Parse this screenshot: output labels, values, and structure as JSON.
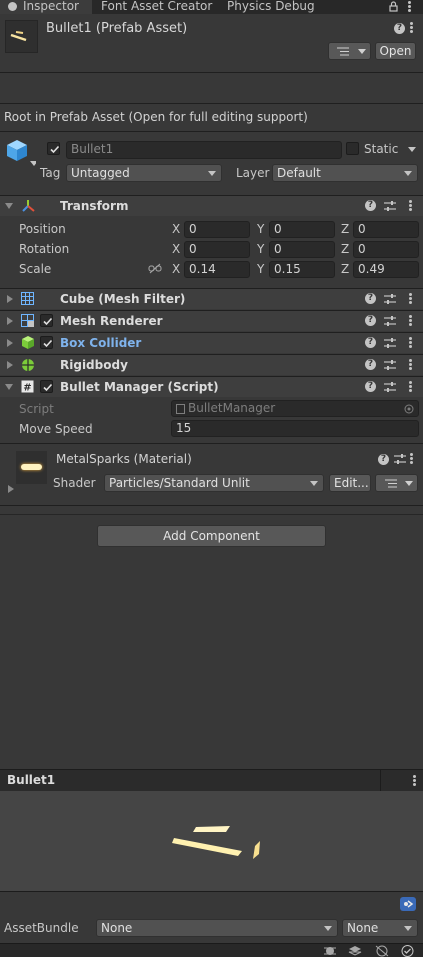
{
  "tabs": [
    {
      "label": "Inspector",
      "active": true
    },
    {
      "label": "Font Asset Creator",
      "active": false
    },
    {
      "label": "Physics Debug",
      "active": false
    }
  ],
  "header": {
    "title": "Bullet1 (Prefab Asset)",
    "open_label": "Open",
    "root_message": "Root in Prefab Asset (Open for full editing support)"
  },
  "gameobject": {
    "name": "Bullet1",
    "active": true,
    "static_label": "Static",
    "tag_label": "Tag",
    "tag_value": "Untagged",
    "layer_label": "Layer",
    "layer_value": "Default"
  },
  "transform": {
    "title": "Transform",
    "rows": [
      {
        "label": "Position",
        "x": "0",
        "y": "0",
        "z": "0"
      },
      {
        "label": "Rotation",
        "x": "0",
        "y": "0",
        "z": "0"
      },
      {
        "label": "Scale",
        "x": "0.14",
        "y": "0.15",
        "z": "0.49"
      }
    ],
    "axis_x": "X",
    "axis_y": "Y",
    "axis_z": "Z"
  },
  "components": [
    {
      "name": "Cube (Mesh Filter)",
      "icon": "mesh-filter-icon",
      "checkbox": false,
      "color": "#dcdcdc"
    },
    {
      "name": "Mesh Renderer",
      "icon": "mesh-renderer-icon",
      "checkbox": true,
      "color": "#dcdcdc"
    },
    {
      "name": "Box Collider",
      "icon": "box-collider-icon",
      "checkbox": true,
      "color": "#7fb3ec"
    },
    {
      "name": "Rigidbody",
      "icon": "rigidbody-icon",
      "checkbox": false,
      "color": "#dcdcdc"
    },
    {
      "name": "Bullet Manager (Script)",
      "icon": "script-icon",
      "checkbox": true,
      "color": "#dcdcdc"
    }
  ],
  "script": {
    "script_label": "Script",
    "script_value": "BulletManager",
    "move_speed_label": "Move Speed",
    "move_speed_value": "15"
  },
  "material": {
    "title": "MetalSparks (Material)",
    "shader_label": "Shader",
    "shader_value": "Particles/Standard Unlit",
    "edit_label": "Edit..."
  },
  "add_component_label": "Add Component",
  "preview": {
    "title": "Bullet1"
  },
  "assetbundle": {
    "label": "AssetBundle",
    "bundle_value": "None",
    "variant_value": "None"
  },
  "colors": {
    "accent_blue": "#7fb3ec",
    "background": "#383838",
    "header": "#3e3e3e"
  }
}
